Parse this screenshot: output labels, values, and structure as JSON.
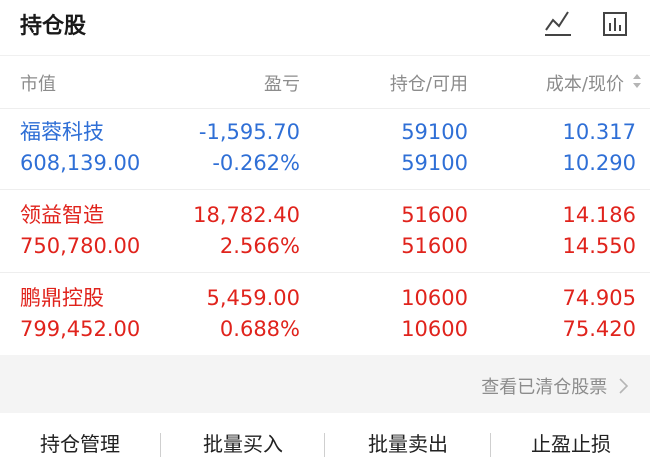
{
  "header": {
    "title": "持仓股",
    "icons": [
      "line-chart-icon",
      "bar-chart-icon"
    ]
  },
  "columns": {
    "market_value": "市值",
    "pnl": "盈亏",
    "holding": "持仓/可用",
    "cost_price": "成本/现价"
  },
  "positions": [
    {
      "name": "福蓉科技",
      "market_value": "608,139.00",
      "pnl": "-1,595.70",
      "pnl_pct": "-0.262%",
      "holding": "59100",
      "available": "59100",
      "cost": "10.317",
      "price": "10.290",
      "trend": "down"
    },
    {
      "name": "领益智造",
      "market_value": "750,780.00",
      "pnl": "18,782.40",
      "pnl_pct": "2.566%",
      "holding": "51600",
      "available": "51600",
      "cost": "14.186",
      "price": "14.550",
      "trend": "up"
    },
    {
      "name": "鹏鼎控股",
      "market_value": "799,452.00",
      "pnl": "5,459.00",
      "pnl_pct": "0.688%",
      "holding": "10600",
      "available": "10600",
      "cost": "74.905",
      "price": "75.420",
      "trend": "up"
    }
  ],
  "cleared_link": "查看已清仓股票",
  "actions": {
    "manage": "持仓管理",
    "batch_buy": "批量买入",
    "batch_sell": "批量卖出",
    "stop": "止盈止损"
  },
  "colors": {
    "up": "#e0231c",
    "down": "#2f6fd6",
    "muted": "#8c8c8c",
    "band": "#f4f4f4"
  }
}
